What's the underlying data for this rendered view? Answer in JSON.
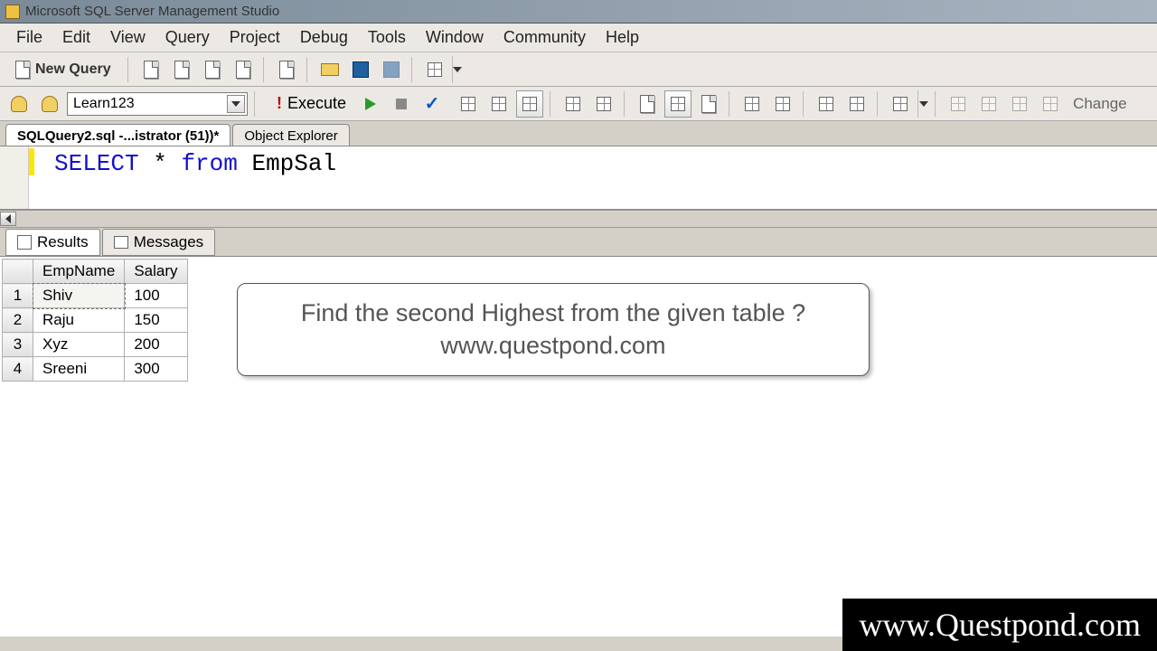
{
  "app": {
    "title": "Microsoft SQL Server Management Studio"
  },
  "menus": [
    "File",
    "Edit",
    "View",
    "Query",
    "Project",
    "Debug",
    "Tools",
    "Window",
    "Community",
    "Help"
  ],
  "toolbar1": {
    "new_query_label": "New Query"
  },
  "toolbar2": {
    "database_selected": "Learn123",
    "execute_label": "Execute",
    "change_label": "Change"
  },
  "tabs": {
    "active": "SQLQuery2.sql -...istrator (51))*",
    "other": "Object Explorer"
  },
  "editor": {
    "kw_select": "SELECT",
    "star": " * ",
    "kw_from": "from",
    "rest": " EmpSal"
  },
  "results_tabs": {
    "results_label": "Results",
    "messages_label": "Messages"
  },
  "results": {
    "columns": [
      "EmpName",
      "Salary"
    ],
    "rows": [
      {
        "n": "1",
        "EmpName": "Shiv",
        "Salary": "100"
      },
      {
        "n": "2",
        "EmpName": "Raju",
        "Salary": "150"
      },
      {
        "n": "3",
        "EmpName": "Xyz",
        "Salary": "200"
      },
      {
        "n": "4",
        "EmpName": "Sreeni",
        "Salary": "300"
      }
    ]
  },
  "callout": {
    "line1": "Find the second Highest from the given table ?",
    "line2": "www.questpond.com"
  },
  "watermark": "www.Questpond.com"
}
